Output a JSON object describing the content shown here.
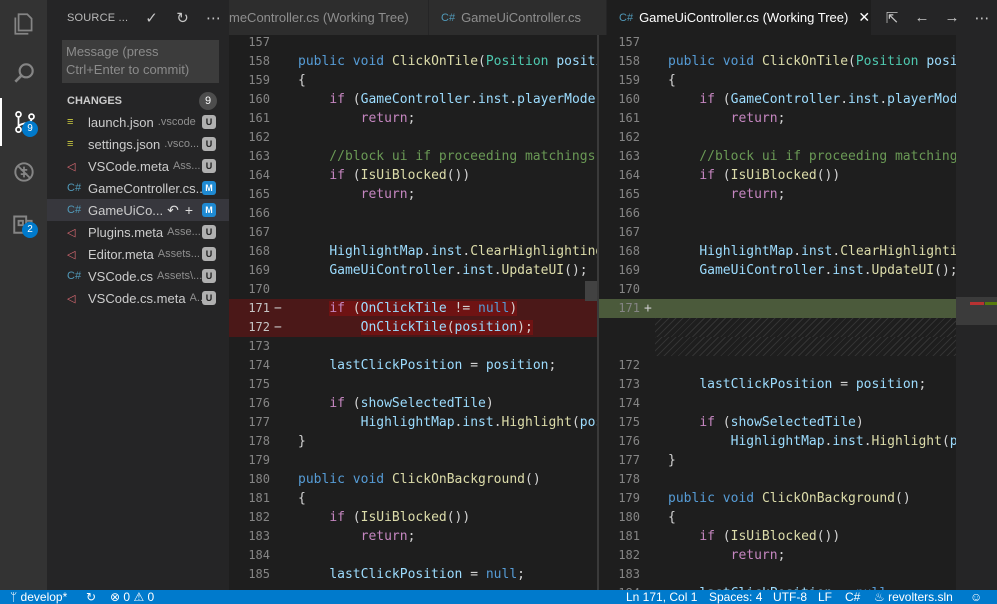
{
  "activity_bar": {
    "scm_badge": "9",
    "extensions_badge": "2"
  },
  "sidebar": {
    "title": "SOURCE ...",
    "commit_placeholder": "Message (press Ctrl+Enter to commit)",
    "changes_label": "CHANGES",
    "changes_count": "9",
    "files": [
      {
        "name": "launch.json",
        "path": ".vscode",
        "status": "U",
        "icon": "json-file-icon"
      },
      {
        "name": "settings.json",
        "path": ".vsco...",
        "status": "U",
        "icon": "json-file-icon"
      },
      {
        "name": "VSCode.meta",
        "path": "Ass...",
        "status": "U",
        "icon": "unity-meta-icon"
      },
      {
        "name": "GameController.cs...",
        "path": "",
        "status": "M",
        "icon": "csharp-file-icon"
      },
      {
        "name": "GameUiCo...",
        "path": "",
        "status": "M",
        "icon": "csharp-file-icon"
      },
      {
        "name": "Plugins.meta",
        "path": "Asse...",
        "status": "U",
        "icon": "unity-meta-icon"
      },
      {
        "name": "Editor.meta",
        "path": "Assets...",
        "status": "U",
        "icon": "unity-meta-icon"
      },
      {
        "name": "VSCode.cs",
        "path": "Assets\\...",
        "status": "U",
        "icon": "csharp-file-icon"
      },
      {
        "name": "VSCode.cs.meta",
        "path": "A...",
        "status": "U",
        "icon": "unity-meta-icon"
      }
    ]
  },
  "tabs": [
    {
      "cs": "",
      "label": "meController.cs (Working Tree)"
    },
    {
      "cs": "C#",
      "label": "GameUiController.cs"
    },
    {
      "cs": "C#",
      "label": "GameUiController.cs (Working Tree)"
    }
  ],
  "diff": {
    "left_lines": [
      {
        "n": "157",
        "t": "",
        "k": "normal"
      },
      {
        "n": "158",
        "t": "public void ClickOnTile(Position position)",
        "k": "normal"
      },
      {
        "n": "159",
        "t": "{",
        "k": "normal"
      },
      {
        "n": "160",
        "t": "    if (GameController.inst.playerMode)",
        "k": "normal"
      },
      {
        "n": "161",
        "t": "        return;",
        "k": "normal"
      },
      {
        "n": "162",
        "t": "",
        "k": "normal"
      },
      {
        "n": "163",
        "t": "    //block ui if proceeding matchings",
        "k": "normal"
      },
      {
        "n": "164",
        "t": "    if (IsUiBlocked())",
        "k": "normal"
      },
      {
        "n": "165",
        "t": "        return;",
        "k": "normal"
      },
      {
        "n": "166",
        "t": "",
        "k": "normal"
      },
      {
        "n": "167",
        "t": "",
        "k": "normal"
      },
      {
        "n": "168",
        "t": "    HighlightMap.inst.ClearHighlighting();",
        "k": "normal"
      },
      {
        "n": "169",
        "t": "    GameUiController.inst.UpdateUI();",
        "k": "normal"
      },
      {
        "n": "170",
        "t": "",
        "k": "normal"
      },
      {
        "n": "171",
        "t": "    if (OnClickTile != null)",
        "k": "removed"
      },
      {
        "n": "172",
        "t": "        OnClickTile(position);",
        "k": "removed"
      },
      {
        "n": "173",
        "t": "",
        "k": "normal"
      },
      {
        "n": "174",
        "t": "    lastClickPosition = position;",
        "k": "normal"
      },
      {
        "n": "175",
        "t": "",
        "k": "normal"
      },
      {
        "n": "176",
        "t": "    if (showSelectedTile)",
        "k": "normal"
      },
      {
        "n": "177",
        "t": "        HighlightMap.inst.Highlight(position);",
        "k": "normal"
      },
      {
        "n": "178",
        "t": "}",
        "k": "normal"
      },
      {
        "n": "179",
        "t": "",
        "k": "normal"
      },
      {
        "n": "180",
        "t": "public void ClickOnBackground()",
        "k": "normal"
      },
      {
        "n": "181",
        "t": "{",
        "k": "normal"
      },
      {
        "n": "182",
        "t": "    if (IsUiBlocked())",
        "k": "normal"
      },
      {
        "n": "183",
        "t": "        return;",
        "k": "normal"
      },
      {
        "n": "184",
        "t": "",
        "k": "normal"
      },
      {
        "n": "185",
        "t": "    lastClickPosition = null;",
        "k": "normal"
      }
    ],
    "right_lines": [
      {
        "n": "157",
        "t": "",
        "k": "normal"
      },
      {
        "n": "158",
        "t": "public void ClickOnTile(Position position)",
        "k": "normal"
      },
      {
        "n": "159",
        "t": "{",
        "k": "normal"
      },
      {
        "n": "160",
        "t": "    if (GameController.inst.playerMode)",
        "k": "normal"
      },
      {
        "n": "161",
        "t": "        return;",
        "k": "normal"
      },
      {
        "n": "162",
        "t": "",
        "k": "normal"
      },
      {
        "n": "163",
        "t": "    //block ui if proceeding matchings",
        "k": "normal"
      },
      {
        "n": "164",
        "t": "    if (IsUiBlocked())",
        "k": "normal"
      },
      {
        "n": "165",
        "t": "        return;",
        "k": "normal"
      },
      {
        "n": "166",
        "t": "",
        "k": "normal"
      },
      {
        "n": "167",
        "t": "",
        "k": "normal"
      },
      {
        "n": "168",
        "t": "    HighlightMap.inst.ClearHighlighting();",
        "k": "normal"
      },
      {
        "n": "169",
        "t": "    GameUiController.inst.UpdateUI();",
        "k": "normal"
      },
      {
        "n": "170",
        "t": "",
        "k": "normal"
      },
      {
        "n": "171",
        "t": "",
        "k": "inserted"
      },
      {
        "n": "",
        "t": "",
        "k": "blank"
      },
      {
        "n": "",
        "t": "",
        "k": "blank"
      },
      {
        "n": "172",
        "t": "",
        "k": "normal"
      },
      {
        "n": "173",
        "t": "    lastClickPosition = position;",
        "k": "normal"
      },
      {
        "n": "174",
        "t": "",
        "k": "normal"
      },
      {
        "n": "175",
        "t": "    if (showSelectedTile)",
        "k": "normal"
      },
      {
        "n": "176",
        "t": "        HighlightMap.inst.Highlight(position);",
        "k": "normal"
      },
      {
        "n": "177",
        "t": "}",
        "k": "normal"
      },
      {
        "n": "178",
        "t": "",
        "k": "normal"
      },
      {
        "n": "179",
        "t": "public void ClickOnBackground()",
        "k": "normal"
      },
      {
        "n": "180",
        "t": "{",
        "k": "normal"
      },
      {
        "n": "181",
        "t": "    if (IsUiBlocked())",
        "k": "normal"
      },
      {
        "n": "182",
        "t": "        return;",
        "k": "normal"
      },
      {
        "n": "183",
        "t": "",
        "k": "normal"
      },
      {
        "n": "184",
        "t": "    lastClickPosition = null;",
        "k": "normal"
      }
    ],
    "sign_removed": "−",
    "sign_inserted": "+"
  },
  "statusbar": {
    "branch": "develop*",
    "errors": "0",
    "warnings": "0",
    "position": "Ln 171, Col 1",
    "spaces": "Spaces: 4",
    "encoding": "UTF-8",
    "eol": "LF",
    "language": "C#",
    "solution": "revolters.sln"
  },
  "colors": {
    "accent": "#007acc",
    "removed_bg": "#4b1818",
    "inserted_bg": "#4b5a3b"
  }
}
